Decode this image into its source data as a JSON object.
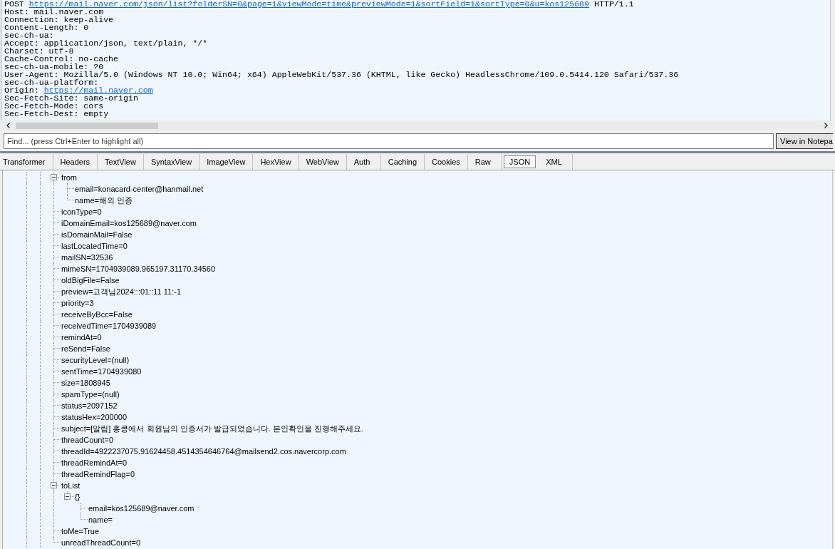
{
  "request": {
    "method": "POST",
    "url": "https://mail.naver.com/json/list?folderSN=0&page=1&viewMode=time&previewMode=1&sortField=1&sortType=0&u=kos125689",
    "version": "HTTP/1.1",
    "headers": [
      {
        "kind": "text",
        "text": "Host: mail.naver.com"
      },
      {
        "kind": "text",
        "text": "Connection: keep-alive"
      },
      {
        "kind": "text",
        "text": "Content-Length: 0"
      },
      {
        "kind": "text",
        "text": "sec-ch-ua:"
      },
      {
        "kind": "text",
        "text": "Accept: application/json, text/plain, */*"
      },
      {
        "kind": "text",
        "text": "Charset: utf-8"
      },
      {
        "kind": "text",
        "text": "Cache-Control: no-cache"
      },
      {
        "kind": "text",
        "text": "sec-ch-ua-mobile: ?0"
      },
      {
        "kind": "text",
        "text": "User-Agent: Mozilla/5.0 (Windows NT 10.0; Win64; x64) AppleWebKit/537.36 (KHTML, like Gecko) HeadlessChrome/109.0.5414.120 Safari/537.36"
      },
      {
        "kind": "text",
        "text": "sec-ch-ua-platform:"
      },
      {
        "kind": "link",
        "label": "Origin:",
        "url": "https://mail.naver.com"
      },
      {
        "kind": "text",
        "text": "Sec-Fetch-Site: same-origin"
      },
      {
        "kind": "text",
        "text": "Sec-Fetch-Mode: cors"
      },
      {
        "kind": "text",
        "text": "Sec-Fetch-Dest: empty"
      }
    ]
  },
  "find": {
    "placeholder": "Find... (press Ctrl+Enter to highlight all)",
    "button": "View in Notepa"
  },
  "tabs": [
    {
      "label": "Transformer",
      "selected": false
    },
    {
      "label": "Headers",
      "selected": false
    },
    {
      "label": "TextView",
      "selected": false
    },
    {
      "label": "SyntaxView",
      "selected": false
    },
    {
      "label": "ImageView",
      "selected": false
    },
    {
      "label": "HexView",
      "selected": false
    },
    {
      "label": "WebView",
      "selected": false
    },
    {
      "label": "Auth",
      "selected": false
    },
    {
      "label": "Caching",
      "selected": false
    },
    {
      "label": "Cookies",
      "selected": false
    },
    {
      "label": "Raw",
      "selected": false
    },
    {
      "label": "JSON",
      "selected": true
    },
    {
      "label": "XML",
      "selected": false
    }
  ],
  "tree": {
    "nodes": [
      {
        "text": "from",
        "expanded": true,
        "children": [
          {
            "text": "email=konacard-center@hanmail.net"
          },
          {
            "text": "name=해외 인증"
          }
        ]
      },
      {
        "text": "iconType=0"
      },
      {
        "text": "iDomainEmail=kos125689@naver.com"
      },
      {
        "text": "isDomainMail=False"
      },
      {
        "text": "lastLocatedTime=0"
      },
      {
        "text": "mailSN=32536"
      },
      {
        "text": "mimeSN=1704939089.965197.31170.34560"
      },
      {
        "text": "oldBigFile=False"
      },
      {
        "text": "preview=고객님2024:::01::11 11:-1"
      },
      {
        "text": "priority=3"
      },
      {
        "text": "receiveByBcc=False"
      },
      {
        "text": "receivedTime=1704939089"
      },
      {
        "text": "remindAt=0"
      },
      {
        "text": "reSend=False"
      },
      {
        "text": "securityLevel=(null)"
      },
      {
        "text": "sentTime=1704939080"
      },
      {
        "text": "size=1808945"
      },
      {
        "text": "spamType=(null)"
      },
      {
        "text": "status=2097152"
      },
      {
        "text": "statusHex=200000"
      },
      {
        "text": "subject=[알림] 홍콩에서 회원님의 인증서가 발급되었습니다. 본인확인을 진행해주세요."
      },
      {
        "text": "threadCount=0"
      },
      {
        "text": "threadId=4922237075.91624458.4514354646764@mailsend2.cos.navercorp.com"
      },
      {
        "text": "threadRemindAt=0"
      },
      {
        "text": "threadRemindFlag=0"
      },
      {
        "text": "toList",
        "expanded": true,
        "children": [
          {
            "text": "{}",
            "expanded": true,
            "children": [
              {
                "text": "email=kos125689@naver.com"
              },
              {
                "text": "name="
              }
            ]
          }
        ]
      },
      {
        "text": "toMe=True"
      },
      {
        "text": "unreadThreadCount=0"
      }
    ]
  }
}
